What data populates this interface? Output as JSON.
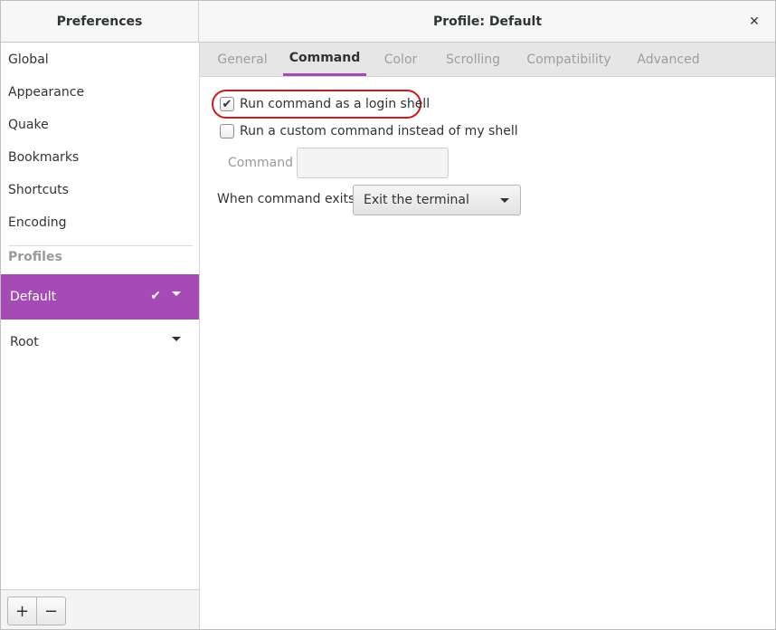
{
  "header": {
    "left_title": "Preferences",
    "right_title": "Profile: Default",
    "close_glyph": "✕"
  },
  "sidebar": {
    "items": [
      {
        "label": "Global"
      },
      {
        "label": "Appearance"
      },
      {
        "label": "Quake"
      },
      {
        "label": "Bookmarks"
      },
      {
        "label": "Shortcuts"
      },
      {
        "label": "Encoding"
      }
    ],
    "profiles_heading": "Profiles",
    "profiles": [
      {
        "label": "Default",
        "selected": true
      },
      {
        "label": "Root",
        "selected": false
      }
    ],
    "add_glyph": "+",
    "remove_glyph": "−"
  },
  "tabs": [
    {
      "label": "General"
    },
    {
      "label": "Command",
      "active": true
    },
    {
      "label": "Color"
    },
    {
      "label": "Scrolling"
    },
    {
      "label": "Compatibility"
    },
    {
      "label": "Advanced"
    }
  ],
  "command_tab": {
    "login_shell": {
      "label": "Run command as a login shell",
      "checked": true
    },
    "custom_command": {
      "label": "Run a custom command instead of my shell",
      "checked": false
    },
    "command_label": "Command",
    "command_value": "",
    "exits_label": "When command exits",
    "exits_value": "Exit the terminal"
  },
  "colors": {
    "accent": "#a64bb5",
    "highlight_ring": "#d01919"
  }
}
